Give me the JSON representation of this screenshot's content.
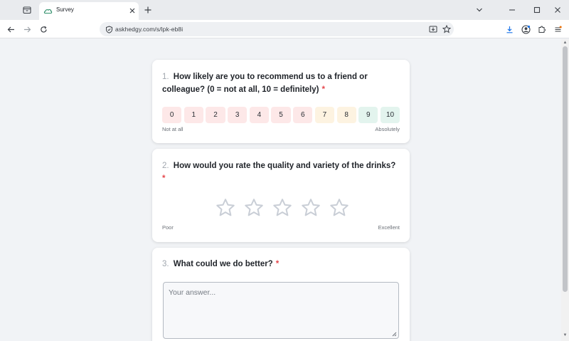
{
  "browser": {
    "tab": {
      "title": "Survey"
    },
    "url": "askhedgy.com/s/lpk-eb8i"
  },
  "questions": [
    {
      "number": "1.",
      "text": "How likely are you to recommend us to a friend or colleague? (0 = not at all, 10 = definitely)",
      "required_mark": "*",
      "type": "nps",
      "options": [
        {
          "label": "0",
          "color": "#fde8e8"
        },
        {
          "label": "1",
          "color": "#fde8e8"
        },
        {
          "label": "2",
          "color": "#fde8e8"
        },
        {
          "label": "3",
          "color": "#fde8e8"
        },
        {
          "label": "4",
          "color": "#fde8e8"
        },
        {
          "label": "5",
          "color": "#fde8e8"
        },
        {
          "label": "6",
          "color": "#fde8e8"
        },
        {
          "label": "7",
          "color": "#fdf3e1"
        },
        {
          "label": "8",
          "color": "#fdf3e1"
        },
        {
          "label": "9",
          "color": "#e3f4ee"
        },
        {
          "label": "10",
          "color": "#e3f4ee"
        }
      ],
      "low_label": "Not at all",
      "high_label": "Absolutely"
    },
    {
      "number": "2.",
      "text": "How would you rate the quality and variety of the drinks?",
      "required_mark": "*",
      "type": "rating",
      "star_count": 5,
      "low_label": "Poor",
      "high_label": "Excellent"
    },
    {
      "number": "3.",
      "text": "What could we do better?",
      "required_mark": "*",
      "type": "text",
      "placeholder": "Your answer..."
    }
  ],
  "colors": {
    "star_outline": "#c9ced6",
    "required": "#e5484d",
    "accent": "#1a73e8"
  }
}
